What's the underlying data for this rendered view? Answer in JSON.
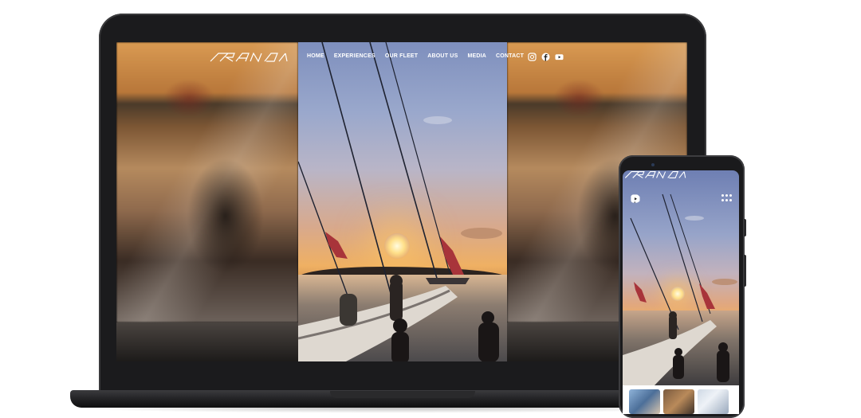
{
  "site": {
    "brand_name": "DRAGOON",
    "nav": [
      "HOME",
      "EXPERIENCES",
      "OUR FLEET",
      "ABOUT US",
      "MEDIA",
      "CONTACT"
    ],
    "social_icons": [
      "instagram-icon",
      "facebook-icon",
      "youtube-icon"
    ]
  },
  "phone": {
    "social_icons": [
      "instagram-icon",
      "facebook-icon",
      "youtube-icon"
    ],
    "menu_icon": "grid-menu-icon",
    "thumbnails": [
      "crew-photo-1",
      "crew-photo-2",
      "crew-photo-3"
    ]
  },
  "colors": {
    "device_frame": "#1b1b1d",
    "nav_text": "#ffffff",
    "sail_flag": "#a8343a",
    "sunset": "#efb063"
  }
}
